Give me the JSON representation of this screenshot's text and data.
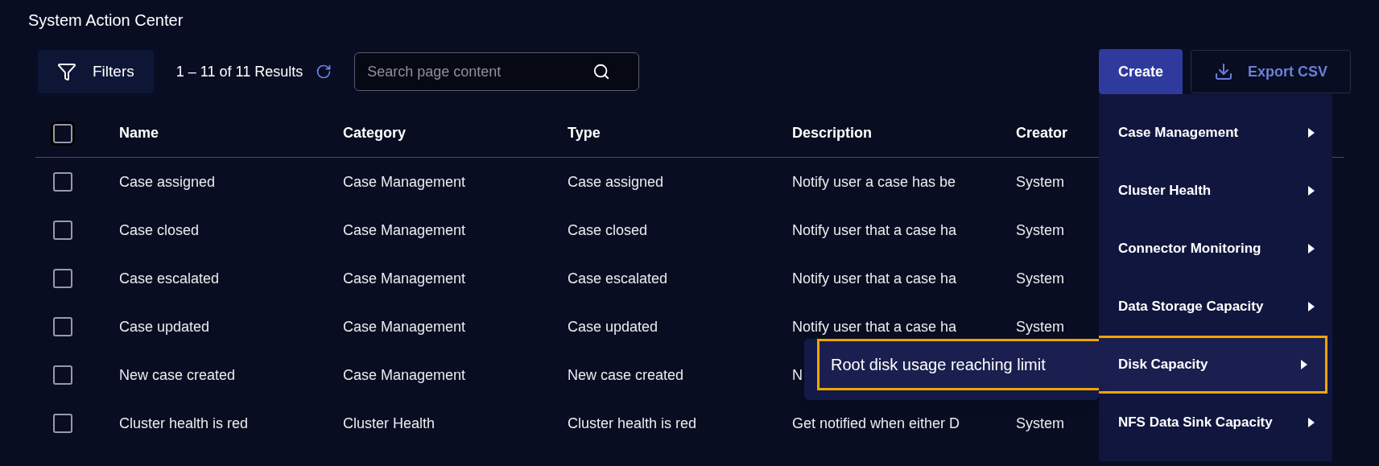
{
  "page": {
    "title": "System Action Center"
  },
  "toolbar": {
    "filters_label": "Filters",
    "results": "1 – 11 of 11 Results",
    "search": {
      "placeholder": "Search page content"
    },
    "create_label": "Create",
    "export_label": "Export CSV"
  },
  "table": {
    "header_checked": false,
    "columns": [
      "Name",
      "Category",
      "Type",
      "Description",
      "Creator"
    ],
    "rows": [
      {
        "checked": false,
        "cells": [
          "Case assigned",
          "Case Management",
          "Case assigned",
          "Notify user a case has be",
          "System"
        ]
      },
      {
        "checked": false,
        "cells": [
          "Case closed",
          "Case Management",
          "Case closed",
          "Notify user that a case ha",
          "System"
        ]
      },
      {
        "checked": false,
        "cells": [
          "Case escalated",
          "Case Management",
          "Case escalated",
          "Notify user that a case ha",
          "System"
        ]
      },
      {
        "checked": false,
        "cells": [
          "Case updated",
          "Case Management",
          "Case updated",
          "Notify user that a case ha",
          "System"
        ]
      },
      {
        "checked": false,
        "cells": [
          "New case created",
          "Case Management",
          "New case created",
          "N"
        ]
      },
      {
        "checked": false,
        "cells": [
          "Cluster health is red",
          "Cluster Health",
          "Cluster health is red",
          "Get notified when either D",
          "System"
        ]
      }
    ]
  },
  "create_menu": {
    "items": [
      {
        "label": "Case Management",
        "selected": false
      },
      {
        "label": "Cluster Health",
        "selected": false
      },
      {
        "label": "Connector Monitoring",
        "selected": false
      },
      {
        "label": "Data Storage Capacity",
        "selected": false
      },
      {
        "label": "Disk Capacity",
        "selected": true,
        "submenu": [
          {
            "label": "Root disk usage reaching limit",
            "selected": true
          }
        ]
      },
      {
        "label": "NFS Data Sink Capacity",
        "selected": false
      }
    ]
  }
}
